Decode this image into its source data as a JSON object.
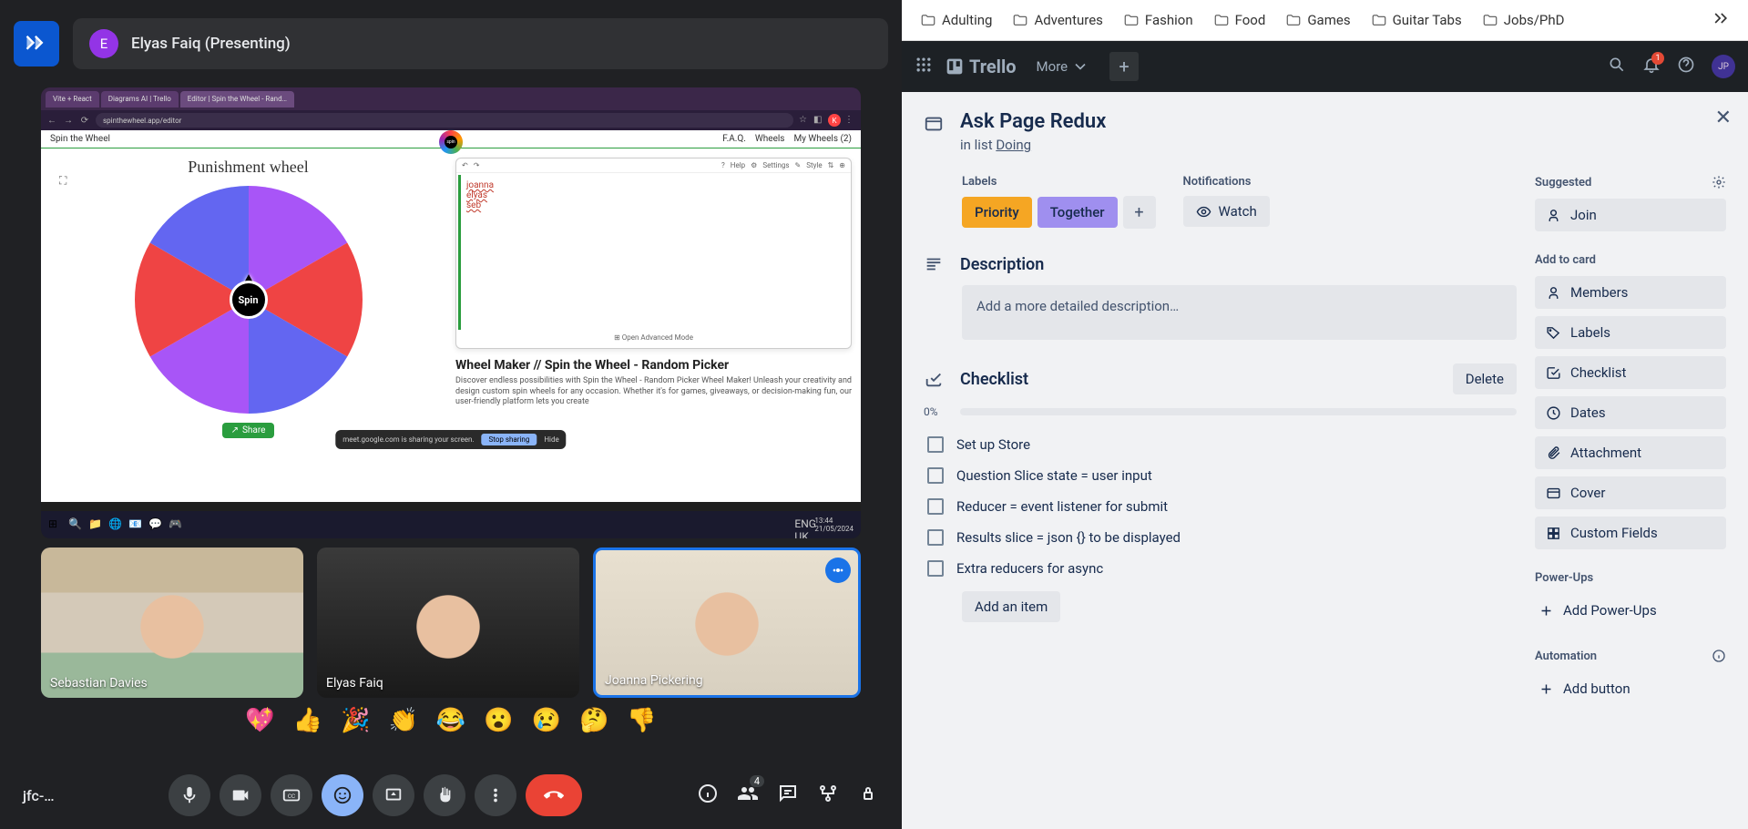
{
  "meet": {
    "presenter_avatar": "E",
    "presenter_label": "Elyas Faiq (Presenting)",
    "meeting_code": "jfc-…",
    "people_count": "4",
    "thumbnails": [
      {
        "name": "Sebastian Davies"
      },
      {
        "name": "Elyas Faiq"
      },
      {
        "name": "Joanna Pickering"
      }
    ],
    "reactions": [
      "💖",
      "👍",
      "🎉",
      "👏",
      "😂",
      "😮",
      "😢",
      "🤔",
      "👎"
    ]
  },
  "shared_screen": {
    "tabs": [
      "Vite + React",
      "Diagrams AI | Trello",
      "Editor | Spin the Wheel - Rand…"
    ],
    "url": "spinthewheel.app/editor",
    "nav_left": "Spin the Wheel",
    "nav_right": [
      "F.A.Q.",
      "Wheels",
      "My Wheels (2)"
    ],
    "wheel_title": "Punishment wheel",
    "spin": "Spin",
    "share": "Share",
    "editor_names": [
      "joanna",
      "elyas",
      "seb"
    ],
    "editor_tools": [
      "Help",
      "Settings",
      "Style"
    ],
    "editor_footer": "Open Advanced Mode",
    "article_title": "Wheel Maker // Spin the Wheel - Random Picker",
    "article_text": "Discover endless possibilities with Spin the Wheel - Random Picker Wheel Maker! Unleash your creativity and design custom spin wheels for any occasion. Whether it's for games, giveaways, or decision-making fun, our user-friendly platform lets you create",
    "sharing_msg": "meet.google.com is sharing your screen.",
    "stop_sharing": "Stop sharing",
    "hide": "Hide",
    "taskbar_time": "13:44",
    "taskbar_date": "21/05/2024",
    "taskbar_lang": "ENG UK"
  },
  "bookmarks": [
    "Adulting",
    "Adventures",
    "Fashion",
    "Food",
    "Games",
    "Guitar Tabs",
    "Jobs/PhD"
  ],
  "trello": {
    "brand": "Trello",
    "more": "More",
    "notif_count": "1",
    "user_initials": "JP",
    "card": {
      "title": "Ask Page Redux",
      "list_prefix": "in list ",
      "list_name": "Doing",
      "labels_heading": "Labels",
      "notif_heading": "Notifications",
      "watch": "Watch",
      "label_priority": "Priority",
      "label_together": "Together",
      "description_heading": "Description",
      "description_placeholder": "Add a more detailed description…",
      "checklist_heading": "Checklist",
      "delete": "Delete",
      "progress": "0%",
      "items": [
        "Set up Store",
        "Question Slice state = user input",
        "Reducer = event listener for submit",
        "Results slice = json {} to be displayed",
        "Extra reducers for async"
      ],
      "add_item": "Add an item"
    },
    "sidebar": {
      "suggested": "Suggested",
      "join": "Join",
      "add_to_card": "Add to card",
      "members": "Members",
      "labels": "Labels",
      "checklist": "Checklist",
      "dates": "Dates",
      "attachment": "Attachment",
      "cover": "Cover",
      "custom_fields": "Custom Fields",
      "power_ups": "Power-Ups",
      "add_power_ups": "Add Power-Ups",
      "automation": "Automation",
      "add_button": "Add button"
    }
  }
}
